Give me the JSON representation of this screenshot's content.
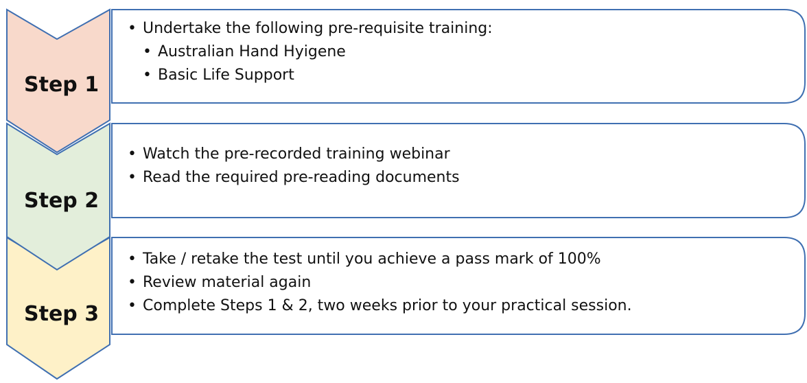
{
  "steps": [
    {
      "label": "Step 1",
      "color": "#F8D9CB",
      "items": [
        {
          "text": "Undertake the following pre-requisite training:",
          "level": 0
        },
        {
          "text": "Australian Hand Hyigene",
          "level": 1
        },
        {
          "text": "Basic Life Support",
          "level": 1
        }
      ]
    },
    {
      "label": "Step 2",
      "color": "#E3EEDB",
      "items": [
        {
          "text": "Watch the pre-recorded training webinar",
          "level": 0
        },
        {
          "text": "Read the required pre-reading documents",
          "level": 0
        }
      ]
    },
    {
      "label": "Step 3",
      "color": "#FEF1C8",
      "items": [
        {
          "text": "Take / retake the test until you achieve a pass mark of 100%",
          "level": 0
        },
        {
          "text": "Review material again",
          "level": 0
        },
        {
          "text": "Complete Steps 1 & 2,  two weeks prior to your practical session.",
          "level": 0
        }
      ]
    }
  ],
  "colors": {
    "outline": "#3F6FB1",
    "text": "#111111"
  }
}
